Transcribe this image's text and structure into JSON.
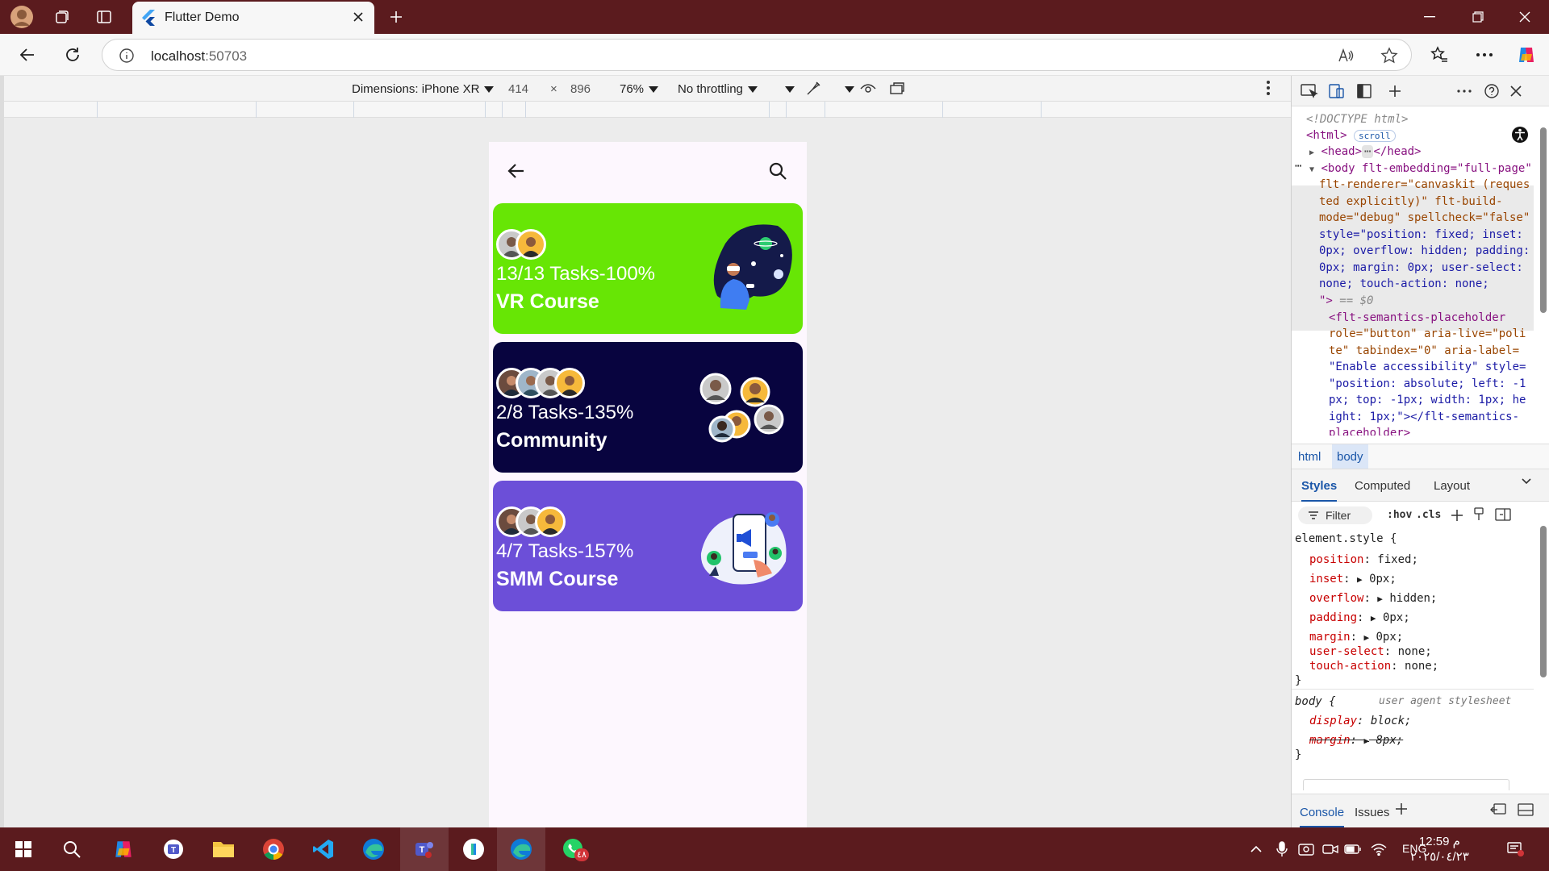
{
  "browser": {
    "tab_title": "Flutter Demo",
    "url_host": "localhost",
    "url_port": ":50703",
    "accent": "#5b1b1e"
  },
  "device_toolbar": {
    "dimensions_label": "Dimensions: iPhone XR",
    "width": "414",
    "times": "×",
    "height": "896",
    "zoom": "76%",
    "throttling": "No throttling"
  },
  "app": {
    "cards": [
      {
        "tasks": "13/13 Tasks-100%",
        "title": "VR Course",
        "color": "#67e605"
      },
      {
        "tasks": "2/8 Tasks-135%",
        "title": "Community",
        "color": "#08043f"
      },
      {
        "tasks": "4/7 Tasks-157%",
        "title": "SMM Course",
        "color": "#6c4fd8"
      }
    ]
  },
  "devtools": {
    "dom": {
      "doctype": "<!DOCTYPE html>",
      "html_open": "<html>",
      "scroll_badge": "scroll",
      "head": "<head>",
      "head_close": "</head>",
      "body_l1": "<body flt-embedding=\"full-page\"",
      "body_l2": "flt-renderer=\"canvaskit (reques",
      "body_l3": "ted explicitly)\" flt-build-",
      "body_l4": "mode=\"debug\" spellcheck=\"false\"",
      "body_l5": "style=\"position: fixed; inset:",
      "body_l6": "0px; overflow: hidden; padding:",
      "body_l7": "0px; margin: 0px; user-select:",
      "body_l8": "none; touch-action: none;",
      "body_l9": "\">",
      "eq": "== $0",
      "sem_l1": "<flt-semantics-placeholder",
      "sem_l2": "role=\"button\" aria-live=\"poli",
      "sem_l3": "te\" tabindex=\"0\" aria-label=",
      "sem_l4": "\"Enable accessibility\" style=",
      "sem_l5": "\"position: absolute; left: -1",
      "sem_l6": "px; top: -1px; width: 1px; he",
      "sem_l7": "ight: 1px;\"></flt-semantics-",
      "sem_l8": "placeholder>"
    },
    "breadcrumbs": [
      "html",
      "body"
    ],
    "style_tabs": [
      "Styles",
      "Computed",
      "Layout"
    ],
    "filter_placeholder": "Filter",
    "hov": ":hov",
    "cls": ".cls",
    "element_style": {
      "selector": "element.style {",
      "props": [
        {
          "name": "position",
          "value": "fixed;"
        },
        {
          "name": "inset",
          "value": "0px;"
        },
        {
          "name": "overflow",
          "value": "hidden;"
        },
        {
          "name": "padding",
          "value": "0px;"
        },
        {
          "name": "margin",
          "value": "0px;"
        },
        {
          "name": "user-select",
          "value": "none;"
        },
        {
          "name": "touch-action",
          "value": "none;"
        }
      ],
      "close": "}"
    },
    "body_rule": {
      "selector": "body {",
      "source": "user agent stylesheet",
      "prop1_name": "display",
      "prop1_value": "block;",
      "prop2_name": "margin",
      "prop2_value": "8px;",
      "close": "}"
    },
    "bottom_tabs": [
      "Console",
      "Issues"
    ]
  },
  "taskbar": {
    "time": "12:59 م",
    "date": "٢٠٢٥/٠٤/٢٣",
    "lang": "ENG",
    "whatsapp_badge": "٤٨"
  }
}
